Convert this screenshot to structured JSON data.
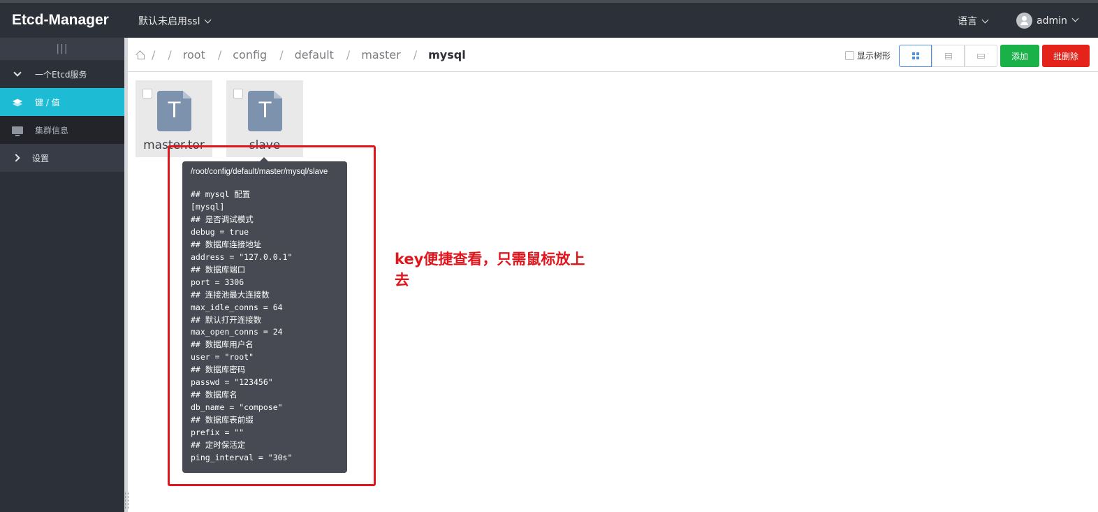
{
  "header": {
    "brand": "Etcd-Manager",
    "server_select": "默认未启用ssl",
    "language": "语言",
    "user": "admin"
  },
  "sidebar": {
    "toggle": "|||",
    "items": [
      {
        "label": "一个Etcd服务",
        "icon": "chevron-down-icon"
      },
      {
        "label": "键 / 值",
        "icon": "layers-icon",
        "active": true
      },
      {
        "label": "集群信息",
        "icon": "monitor-icon"
      },
      {
        "label": "设置",
        "icon": "chevron-right-icon"
      }
    ]
  },
  "breadcrumb": {
    "items": [
      "root",
      "config",
      "default",
      "master",
      "mysql"
    ],
    "separator": "/"
  },
  "toolbar": {
    "show_tree_label": "显示树形",
    "add_label": "添加",
    "batch_delete_label": "批删除"
  },
  "files": [
    {
      "name": "master.tor"
    },
    {
      "name": "slave"
    }
  ],
  "tooltip": {
    "path": "/root/config/default/master/mysql/slave",
    "content": "## mysql 配置\n[mysql]\n## 是否调试模式\ndebug = true\n## 数据库连接地址\naddress = \"127.0.0.1\"\n## 数据库端口\nport = 3306\n## 连接池最大连接数\nmax_idle_conns = 64\n## 默认打开连接数\nmax_open_conns = 24\n## 数据库用户名\nuser = \"root\"\n## 数据库密码\npasswd = \"123456\"\n## 数据库名\ndb_name = \"compose\"\n## 数据库表前缀\nprefix = \"\"\n## 定时保活定\nping_interval = \"30s\""
  },
  "annotation": {
    "text": "key便捷查看，只需鼠标放上去",
    "color": "#e0161c"
  },
  "colors": {
    "accent": "#1ebbd4",
    "add": "#19b148",
    "delete": "#e4241b"
  }
}
